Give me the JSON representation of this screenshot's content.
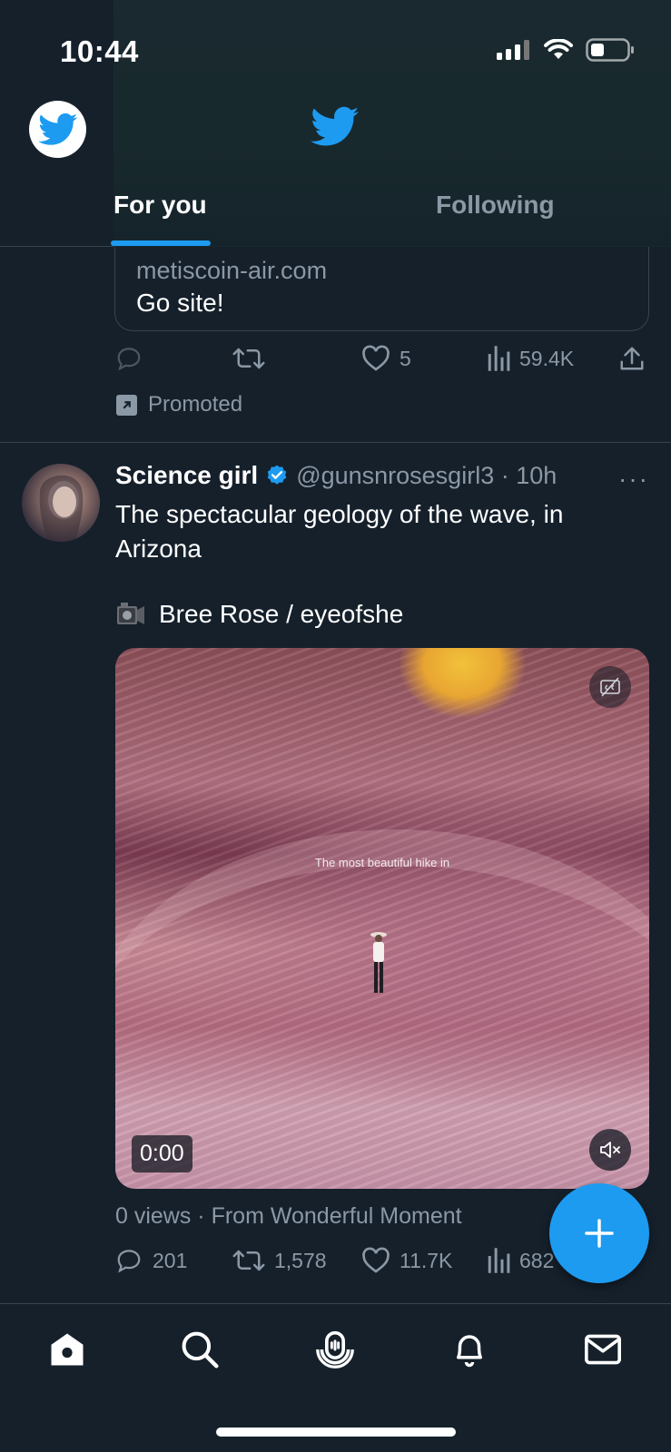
{
  "status": {
    "time": "10:44"
  },
  "header": {
    "tabs": [
      {
        "label": "For you",
        "active": true
      },
      {
        "label": "Following",
        "active": false
      }
    ]
  },
  "promoted_tweet": {
    "card_domain": "metiscoin-air.com",
    "card_cta": "Go site!",
    "likes": "5",
    "views": "59.4K",
    "promoted_label": "Promoted"
  },
  "tweet": {
    "name": "Science girl",
    "handle_time": "@gunsnrosesgirl3 · 10h",
    "more": "···",
    "text": "The spectacular geology of the wave, in Arizona",
    "credit": "Bree Rose / eyeofshe",
    "media": {
      "caption": "The most beautiful hike in",
      "timer": "0:00"
    },
    "views_line": "0 views · From Wonderful Moment",
    "replies": "201",
    "retweets": "1,578",
    "likes": "11.7K",
    "views": "682"
  },
  "colors": {
    "background": "#15202b",
    "accent": "#1d9bf0",
    "secondary_text": "#8b98a5",
    "border": "#38444d"
  },
  "icons": [
    "twitter-bird-icon",
    "reply-icon",
    "retweet-icon",
    "like-icon",
    "views-icon",
    "share-icon",
    "verified-icon",
    "captions-icon",
    "mute-icon",
    "compose-plus-icon",
    "home-icon",
    "search-icon",
    "spaces-icon",
    "notifications-icon",
    "messages-icon"
  ]
}
